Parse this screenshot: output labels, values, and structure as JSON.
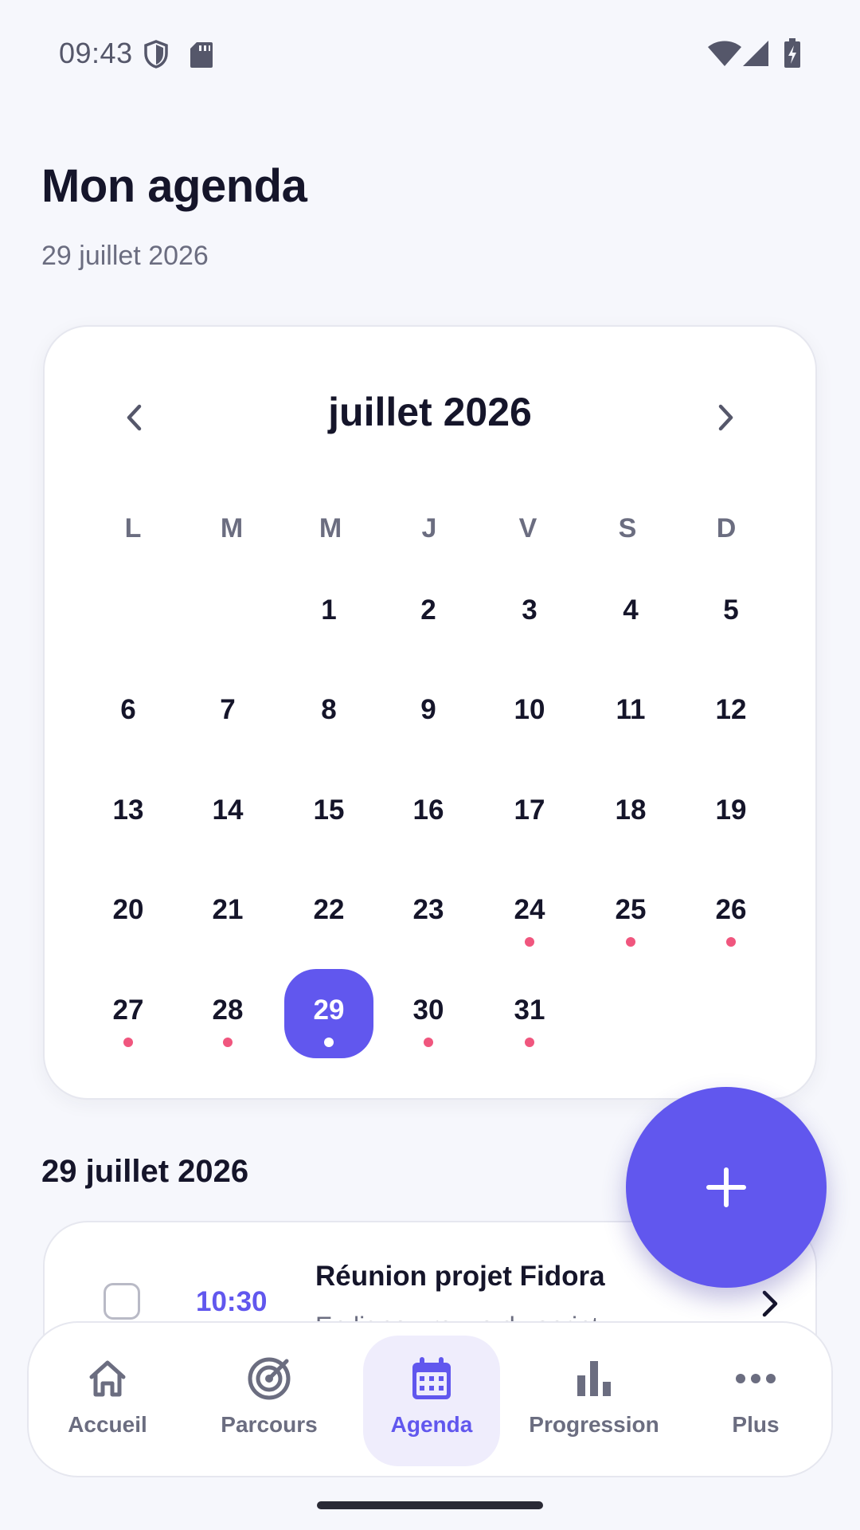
{
  "status_bar": {
    "time": "09:43"
  },
  "header": {
    "title": "Mon agenda",
    "date": "29 juillet 2026"
  },
  "calendar": {
    "month_label": "juillet 2026",
    "weekdays": [
      "L",
      "M",
      "M",
      "J",
      "V",
      "S",
      "D"
    ],
    "first_weekday_index": 2,
    "days": [
      "1",
      "2",
      "3",
      "4",
      "5",
      "6",
      "7",
      "8",
      "9",
      "10",
      "11",
      "12",
      "13",
      "14",
      "15",
      "16",
      "17",
      "18",
      "19",
      "20",
      "21",
      "22",
      "23",
      "24",
      "25",
      "26",
      "27",
      "28",
      "29",
      "30",
      "31"
    ],
    "days_with_events": [
      24,
      25,
      26,
      27,
      28,
      29,
      30,
      31
    ],
    "selected_day": 29
  },
  "section": {
    "title": "29 juillet 2026"
  },
  "events": [
    {
      "time": "10:30",
      "title": "Réunion projet Fidora",
      "detail": "En ligne · revue du sprint"
    }
  ],
  "fab": {
    "icon": "plus-icon"
  },
  "nav": {
    "items": [
      {
        "label": "Accueil",
        "icon": "home-icon"
      },
      {
        "label": "Parcours",
        "icon": "target-icon"
      },
      {
        "label": "Agenda",
        "icon": "calendar-icon"
      },
      {
        "label": "Progression",
        "icon": "bar-chart-icon"
      },
      {
        "label": "Plus",
        "icon": "more-icon"
      }
    ],
    "active_index": 2
  },
  "colors": {
    "accent": "#6157ee",
    "event_dot": "#f0567e",
    "text": "#15152a",
    "muted": "#6b6d80",
    "background": "#f6f7fc"
  }
}
